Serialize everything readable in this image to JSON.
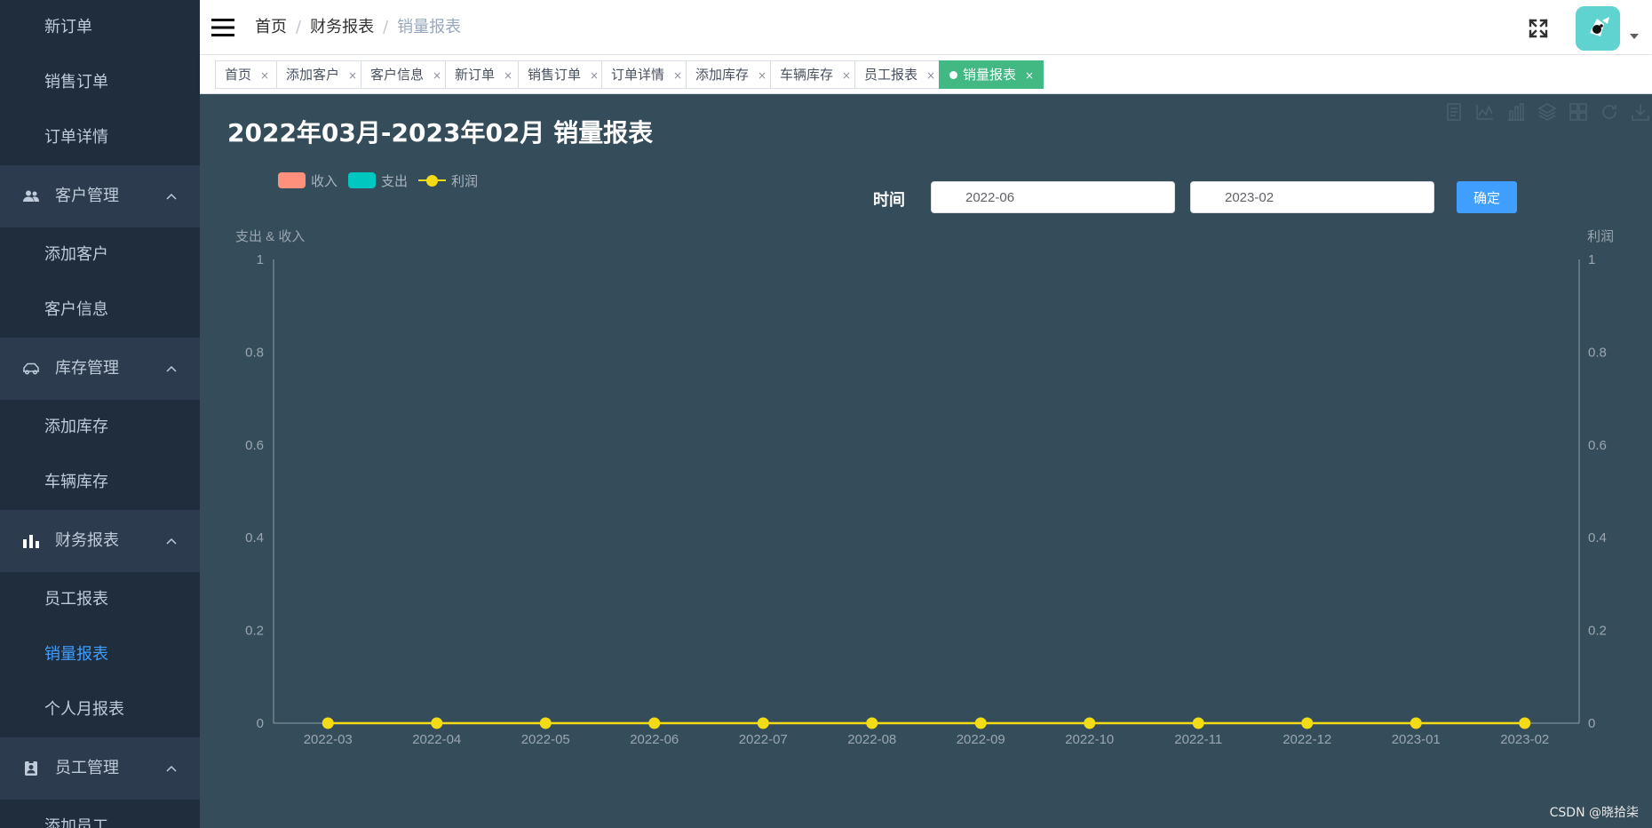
{
  "sidebar": {
    "items": [
      {
        "kind": "sub",
        "label": "新订单",
        "active": false
      },
      {
        "kind": "sub",
        "label": "销售订单",
        "active": false
      },
      {
        "kind": "sub",
        "label": "订单详情",
        "active": false
      },
      {
        "kind": "group",
        "label": "客户管理",
        "icon": "users-icon"
      },
      {
        "kind": "sub",
        "label": "添加客户",
        "active": false
      },
      {
        "kind": "sub",
        "label": "客户信息",
        "active": false
      },
      {
        "kind": "group",
        "label": "库存管理",
        "icon": "car-icon"
      },
      {
        "kind": "sub",
        "label": "添加库存",
        "active": false
      },
      {
        "kind": "sub",
        "label": "车辆库存",
        "active": false
      },
      {
        "kind": "group",
        "label": "财务报表",
        "icon": "bar-chart-icon"
      },
      {
        "kind": "sub",
        "label": "员工报表",
        "active": false
      },
      {
        "kind": "sub",
        "label": "销量报表",
        "active": true
      },
      {
        "kind": "sub",
        "label": "个人月报表",
        "active": false
      },
      {
        "kind": "group",
        "label": "员工管理",
        "icon": "badge-icon"
      },
      {
        "kind": "sub",
        "label": "添加员工",
        "active": false
      }
    ]
  },
  "navbar": {
    "breadcrumb": [
      "首页",
      "财务报表",
      "销量报表"
    ],
    "separator": "/"
  },
  "tags": [
    {
      "label": "首页",
      "active": false
    },
    {
      "label": "添加客户",
      "active": false
    },
    {
      "label": "客户信息",
      "active": false
    },
    {
      "label": "新订单",
      "active": false
    },
    {
      "label": "销售订单",
      "active": false
    },
    {
      "label": "订单详情",
      "active": false
    },
    {
      "label": "添加库存",
      "active": false
    },
    {
      "label": "车辆库存",
      "active": false
    },
    {
      "label": "员工报表",
      "active": false
    },
    {
      "label": "销量报表",
      "active": true
    }
  ],
  "tag_close": "×",
  "report": {
    "title": "2022年03月-2023年02月 销量报表",
    "time_label": "时间",
    "start_value": "2022-06",
    "end_value": "2023-02",
    "confirm_label": "确定"
  },
  "toolbox_icons": [
    "data-view-icon",
    "line-switch-icon",
    "bar-switch-icon",
    "stack-icon",
    "tiled-icon",
    "restore-icon",
    "save-image-icon"
  ],
  "chart_data": {
    "type": "bar",
    "categories": [
      "2022-03",
      "2022-04",
      "2022-05",
      "2022-06",
      "2022-07",
      "2022-08",
      "2022-09",
      "2022-10",
      "2022-11",
      "2022-12",
      "2023-01",
      "2023-02"
    ],
    "series": [
      {
        "name": "收入",
        "type": "bar",
        "color": "#ff917c",
        "values": [
          0,
          0,
          0,
          0,
          0,
          0,
          0,
          0,
          0,
          0,
          0,
          0
        ]
      },
      {
        "name": "支出",
        "type": "bar",
        "color": "#00c7c0",
        "values": [
          0,
          0,
          0,
          0,
          0,
          0,
          0,
          0,
          0,
          0,
          0,
          0
        ]
      },
      {
        "name": "利润",
        "type": "line",
        "color": "#f3dc16",
        "values": [
          0,
          0,
          0,
          0,
          0,
          0,
          0,
          0,
          0,
          0,
          0,
          0
        ]
      }
    ],
    "ylabel_left": "支出 & 收入",
    "ylabel_right": "利润",
    "ylim": [
      0,
      1
    ],
    "yticks": [
      "1",
      "0.8",
      "0.6",
      "0.4",
      "0.2",
      "0"
    ],
    "legend_position": "top-left",
    "grid": false,
    "background": "#354c5a"
  },
  "watermark": "CSDN @晓拾柒"
}
